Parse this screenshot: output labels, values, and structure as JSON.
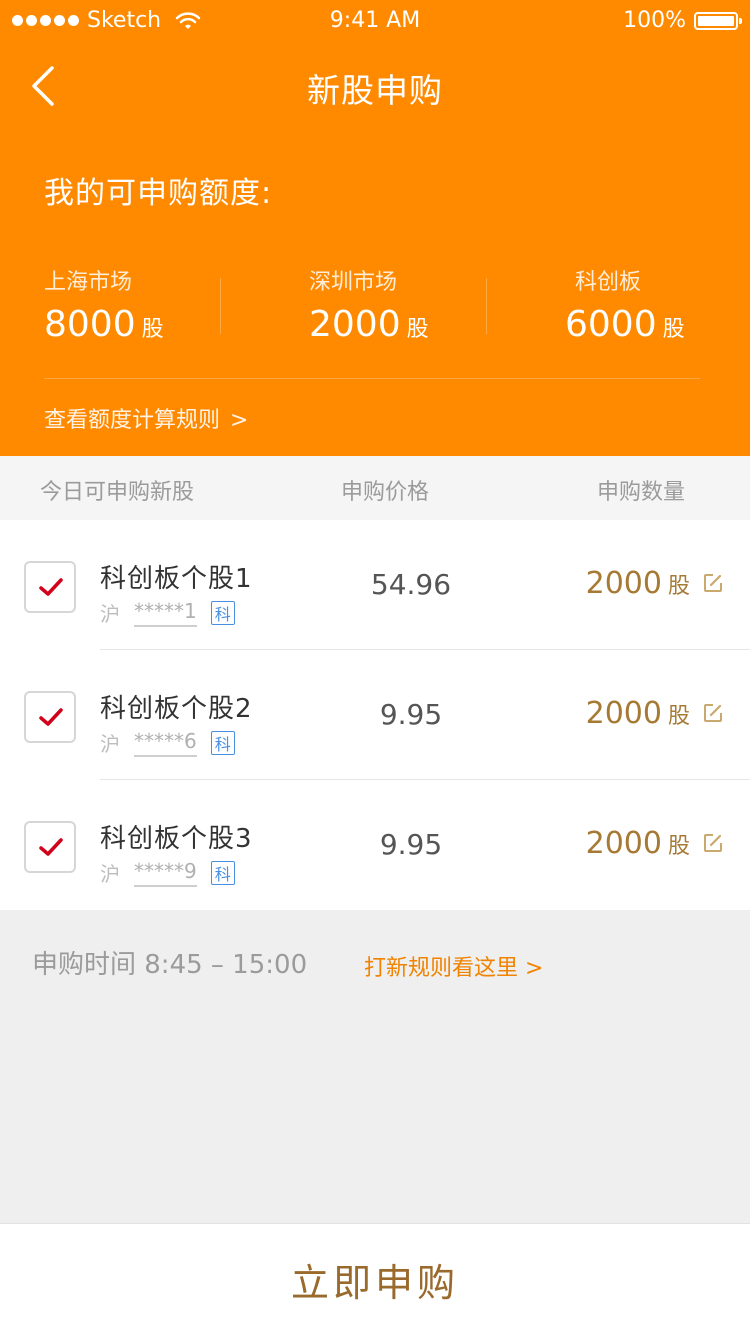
{
  "status_bar": {
    "carrier": "Sketch",
    "time": "9:41 AM",
    "battery": "100%"
  },
  "nav": {
    "title": "新股申购"
  },
  "quota": {
    "title": "我的可申购额度:",
    "markets": [
      {
        "label": "上海市场",
        "amount": "8000",
        "unit": "股"
      },
      {
        "label": "深圳市场",
        "amount": "2000",
        "unit": "股"
      },
      {
        "label": "科创板",
        "amount": "6000",
        "unit": "股"
      }
    ],
    "rules_link": "查看额度计算规则",
    "rules_chevron": ">"
  },
  "table": {
    "headers": [
      "今日可申购新股",
      "申购价格",
      "申购数量"
    ],
    "rows": [
      {
        "name": "科创板个股1",
        "exchange": "沪",
        "code": "*****1",
        "tag": "科",
        "price": "54.96",
        "qty": "2000",
        "unit": "股",
        "checked": true
      },
      {
        "name": "科创板个股2",
        "exchange": "沪",
        "code": "*****6",
        "tag": "科",
        "price": "9.95",
        "qty": "2000",
        "unit": "股",
        "checked": true
      },
      {
        "name": "科创板个股3",
        "exchange": "沪",
        "code": "*****9",
        "tag": "科",
        "price": "9.95",
        "qty": "2000",
        "unit": "股",
        "checked": true
      }
    ]
  },
  "subscribe_time": {
    "text": "申购时间 8:45 – 15:00",
    "link": "打新规则看这里 >"
  },
  "actions": {
    "submit": "立即申购"
  },
  "colors": {
    "orange": "#ff8a00",
    "gold_text": "#a67a35",
    "link_orange": "#f08300",
    "check_red": "#d0021b"
  },
  "icons": {
    "back": "chevron-left",
    "checkbox": "checkmark",
    "edit": "pencil-square",
    "wifi": "wifi",
    "battery": "battery"
  }
}
